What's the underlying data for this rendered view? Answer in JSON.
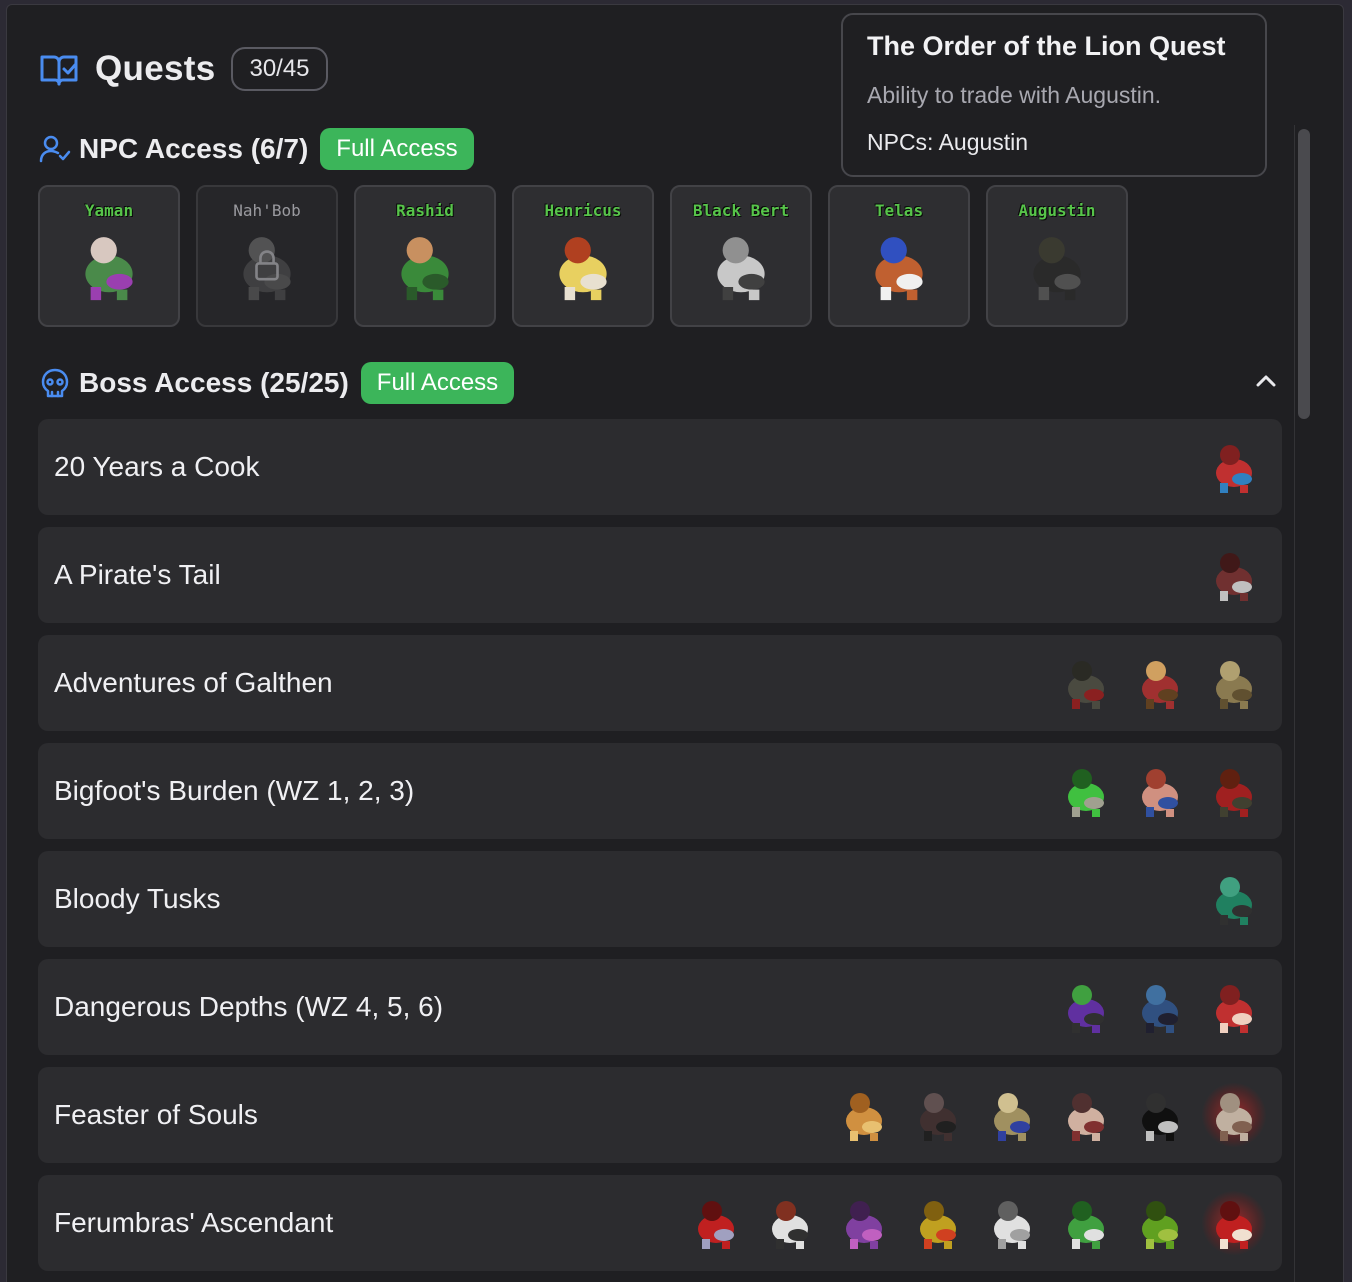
{
  "header": {
    "title": "Quests",
    "count": "30/45",
    "icon": "book-check-icon"
  },
  "npc_section": {
    "title": "NPC Access (6/7)",
    "badge": "Full Access",
    "icon": "user-check-icon"
  },
  "npcs": [
    {
      "name": "Yaman",
      "locked": false,
      "colors": [
        "#4a8a4a",
        "#9a3fb0",
        "#d8c8c0"
      ]
    },
    {
      "name": "Nah'Bob",
      "locked": true,
      "colors": [
        "#555",
        "#666",
        "#777"
      ]
    },
    {
      "name": "Rashid",
      "locked": false,
      "colors": [
        "#3a8a3a",
        "#2a5a2a",
        "#c89060"
      ]
    },
    {
      "name": "Henricus",
      "locked": false,
      "colors": [
        "#e8d060",
        "#e8e0d0",
        "#b04020"
      ]
    },
    {
      "name": "Black Bert",
      "locked": false,
      "colors": [
        "#c8c8c8",
        "#404040",
        "#909090"
      ]
    },
    {
      "name": "Telas",
      "locked": false,
      "colors": [
        "#c06030",
        "#f0f0f0",
        "#3050c0"
      ]
    },
    {
      "name": "Augustin",
      "locked": false,
      "colors": [
        "#2a2a2a",
        "#505050",
        "#3a3a30"
      ]
    }
  ],
  "boss_section": {
    "title": "Boss Access (25/25)",
    "badge": "Full Access",
    "icon": "skull-icon"
  },
  "quests": [
    {
      "name": "20 Years a Cook",
      "bosses": [
        {
          "name": "cook-boss-sprite",
          "colors": [
            "#c03030",
            "#3080c0",
            "#802020"
          ],
          "glow": false
        }
      ]
    },
    {
      "name": "A Pirate's Tail",
      "bosses": [
        {
          "name": "pirate-boss-sprite",
          "colors": [
            "#703030",
            "#c0c0c0",
            "#401818"
          ],
          "glow": false
        }
      ]
    },
    {
      "name": "Adventures of Galthen",
      "bosses": [
        {
          "name": "galthen-boss-1-sprite",
          "colors": [
            "#4a4a40",
            "#8a2020",
            "#2a2a24"
          ],
          "glow": false
        },
        {
          "name": "galthen-boss-2-sprite",
          "colors": [
            "#a03030",
            "#604020",
            "#d0a060"
          ],
          "glow": false
        },
        {
          "name": "galthen-boss-3-sprite",
          "colors": [
            "#8a7a50",
            "#605030",
            "#b0a070"
          ],
          "glow": false
        }
      ]
    },
    {
      "name": "Bigfoot's Burden (WZ 1, 2, 3)",
      "bosses": [
        {
          "name": "bigfoot-boss-1-sprite",
          "colors": [
            "#40c040",
            "#a0a090",
            "#206020"
          ],
          "glow": false
        },
        {
          "name": "bigfoot-boss-2-sprite",
          "colors": [
            "#d09080",
            "#3050a0",
            "#a04030"
          ],
          "glow": false
        },
        {
          "name": "bigfoot-boss-3-sprite",
          "colors": [
            "#a02020",
            "#404030",
            "#602010"
          ],
          "glow": false
        }
      ]
    },
    {
      "name": "Bloody Tusks",
      "bosses": [
        {
          "name": "tusks-boss-sprite",
          "colors": [
            "#208060",
            "#303030",
            "#40a080"
          ],
          "glow": false
        }
      ]
    },
    {
      "name": "Dangerous Depths (WZ 4, 5, 6)",
      "bosses": [
        {
          "name": "depths-boss-1-sprite",
          "colors": [
            "#6030a0",
            "#303030",
            "#40a040"
          ],
          "glow": false
        },
        {
          "name": "depths-boss-2-sprite",
          "colors": [
            "#305080",
            "#202030",
            "#4070a0"
          ],
          "glow": false
        },
        {
          "name": "depths-boss-3-sprite",
          "colors": [
            "#c03030",
            "#f0d0c0",
            "#802020"
          ],
          "glow": false
        }
      ]
    },
    {
      "name": "Feaster of Souls",
      "bosses": [
        {
          "name": "feaster-boss-1-sprite",
          "colors": [
            "#d09040",
            "#e8c070",
            "#a06020"
          ],
          "glow": false
        },
        {
          "name": "feaster-boss-2-sprite",
          "colors": [
            "#403030",
            "#202020",
            "#605050"
          ],
          "glow": false
        },
        {
          "name": "feaster-boss-3-sprite",
          "colors": [
            "#a09060",
            "#3040a0",
            "#d0c090"
          ],
          "glow": false
        },
        {
          "name": "feaster-boss-4-sprite",
          "colors": [
            "#d0b0a0",
            "#803030",
            "#503030"
          ],
          "glow": false
        },
        {
          "name": "feaster-boss-5-sprite",
          "colors": [
            "#101010",
            "#c0c0c0",
            "#303030"
          ],
          "glow": false
        },
        {
          "name": "feaster-boss-6-sprite",
          "colors": [
            "#c0b0a0",
            "#806050",
            "#a09080"
          ],
          "glow": true
        }
      ]
    },
    {
      "name": "Ferumbras' Ascendant",
      "bosses": [
        {
          "name": "ferumbras-boss-1-sprite",
          "colors": [
            "#c02020",
            "#a0a0c0",
            "#601010"
          ],
          "glow": false
        },
        {
          "name": "ferumbras-boss-2-sprite",
          "colors": [
            "#e0e0e0",
            "#303030",
            "#803020"
          ],
          "glow": false
        },
        {
          "name": "ferumbras-boss-3-sprite",
          "colors": [
            "#8040a0",
            "#c060c0",
            "#402050"
          ],
          "glow": false
        },
        {
          "name": "ferumbras-boss-4-sprite",
          "colors": [
            "#c0a020",
            "#d04020",
            "#806010"
          ],
          "glow": false
        },
        {
          "name": "ferumbras-boss-5-sprite",
          "colors": [
            "#e0e0e0",
            "#a0a0a0",
            "#606060"
          ],
          "glow": false
        },
        {
          "name": "ferumbras-boss-6-sprite",
          "colors": [
            "#40a040",
            "#e0e0e0",
            "#206020"
          ],
          "glow": false
        },
        {
          "name": "ferumbras-boss-7-sprite",
          "colors": [
            "#60a020",
            "#a0c040",
            "#305010"
          ],
          "glow": false
        },
        {
          "name": "ferumbras-boss-8-sprite",
          "colors": [
            "#c02020",
            "#f0e0d0",
            "#601010"
          ],
          "glow": true
        }
      ]
    }
  ],
  "tooltip": {
    "title": "The Order of the Lion Quest",
    "description": "Ability to trade with Augustin.",
    "npcs": "NPCs: Augustin"
  },
  "colors": {
    "accent": "#4a8cf0",
    "badge_green": "#3cb55a",
    "npc_name_green": "#57c44a"
  }
}
